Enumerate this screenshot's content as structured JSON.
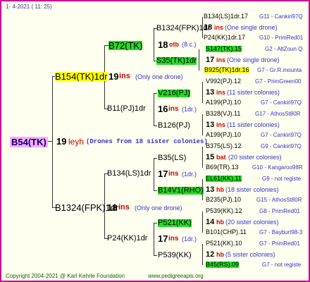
{
  "header": {
    "date": "1-  4-2021  ( 11: 25)"
  },
  "root": {
    "id": "B54(TK)",
    "count": "19",
    "breeder": "leyh",
    "note": "Drones from 18 sister colonies"
  },
  "gen1": [
    {
      "id": "B154(TK)1dr",
      "count": "19",
      "unit": "ins",
      "note": "(Only one drone)"
    },
    {
      "id": "B1324(FPK)1dr",
      "count": "18",
      "unit": "ins",
      "note": "(Only one drone)"
    }
  ],
  "gen2": [
    {
      "id": "B72(TK)"
    },
    {
      "id": "B11(PJ)1dr",
      "count": "16",
      "unit": "ins",
      "note": "(1dr.)"
    },
    {
      "id": "B134(LS)1dr",
      "count": "17",
      "unit": "ins",
      "note": "(1dr.)"
    },
    {
      "id": "P24(KK)1dr",
      "count": "17",
      "unit": "ins",
      "note": "(1dr.)"
    }
  ],
  "gen3": [
    {
      "id": "B1324(FPK)1dr",
      "count": "18",
      "unit": "otb",
      "note": "(8 c.)"
    },
    {
      "id": "S35(TK)1dr"
    },
    {
      "id": "V216(PJ)"
    },
    {
      "id": "B126(PJ)"
    },
    {
      "id": "B35(LS)"
    },
    {
      "id": "B14V1(RHO)"
    },
    {
      "id": "P521(KK)"
    },
    {
      "id": "P539(KK)"
    }
  ],
  "gen4": [
    {
      "id": "B134(LS)1dr.17",
      "ref": "G11 - Cankiri97Q"
    },
    {
      "count": "18",
      "unit": "ins",
      "note": "(One single drone)"
    },
    {
      "id": "P24(KK)1dr.17",
      "ref": "G10 - PrimRed01"
    },
    {
      "id": "S147(TK).15",
      "ref": "G2 - AltZoun Q"
    },
    {
      "count": "17",
      "unit": "ins",
      "note": "(One single drone)"
    },
    {
      "id": "B925(TK)1dr.16",
      "ref": "G7 - Gr.R.mounta"
    },
    {
      "id": "V992(PJ).12",
      "ref": "G7 - PrimGreen00"
    },
    {
      "count": "13",
      "unit": "ins",
      "note": "(11 sister colonies)"
    },
    {
      "id": "A199(PJ).10",
      "ref": "G7 - Cankiri97Q"
    },
    {
      "id": "B328(VJ).11",
      "ref": "G17 - AthosSt80R"
    },
    {
      "count": "13",
      "unit": "ins",
      "note": "(11 sister colonies)"
    },
    {
      "id": "A199(PJ).10",
      "ref": "G7 - Cankiri97Q"
    },
    {
      "id": "B375(LS).12",
      "ref": "G9 - Cankiri97Q"
    },
    {
      "count": "15",
      "unit": "bat",
      "note": "(20 sister colonies)"
    },
    {
      "id": "B69(TR).13",
      "ref": "G10 - Kangaroo98R"
    },
    {
      "id": "EL61(KK).11",
      "ref": "G9 - not registe"
    },
    {
      "count": "13",
      "unit": "hb",
      "note": "(18 sister colonies)"
    },
    {
      "id": "B235(PJ).10",
      "ref": "G15 - AthosSt80R"
    },
    {
      "id": "P539(KK).12",
      "ref": "G8 - PrimRed01"
    },
    {
      "count": "14",
      "unit": "hb",
      "note": "(20 sister colonies)"
    },
    {
      "id": "B101(CHP).11",
      "ref": "G7 - Bayburt98-3"
    },
    {
      "id": "P521(KK).10",
      "ref": "G7 - PrimRed01"
    },
    {
      "count": "12",
      "unit": "hb",
      "note": "(5 sister colonies)"
    },
    {
      "id": "B45(RS).09",
      "ref": "G7 - not registe"
    }
  ],
  "footer": {
    "copyright": "Copyright 2004-2021 @ Karl Kehrle Foundation",
    "site": "www.pedigreeapis.org"
  },
  "colors": {
    "frame": "#cc0099",
    "green_box": "#22dd22",
    "yellow_box": "#ffff00",
    "root_box": "#ffaaff"
  }
}
